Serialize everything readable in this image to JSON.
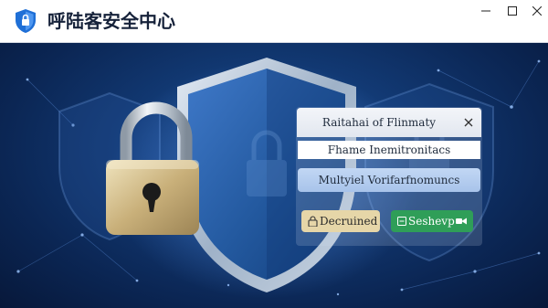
{
  "window": {
    "title": "呼陆客安全中心",
    "controls": {
      "minimize": "minimize",
      "maximize": "maximize",
      "close": "close"
    }
  },
  "dialog": {
    "title": "Raitahai of Flinmaty",
    "field_text": "Fhame Inemitronitacs",
    "mfa_label": "Multyiel Vorifarfnomuncs",
    "decline_label": "Decruined",
    "setup_label": "Seshevp"
  },
  "icons": {
    "app": "shield-icon",
    "dialog_close": "close-icon",
    "decline": "lock-icon",
    "setup_left": "save-icon",
    "setup_right": "video-icon"
  },
  "colors": {
    "hero_bg": "#123a75",
    "setup_button": "#2f9e58",
    "decline_button": "#e6d6a8",
    "mfa_button": "#b5cdf0",
    "app_icon": "#1f6fd6"
  }
}
